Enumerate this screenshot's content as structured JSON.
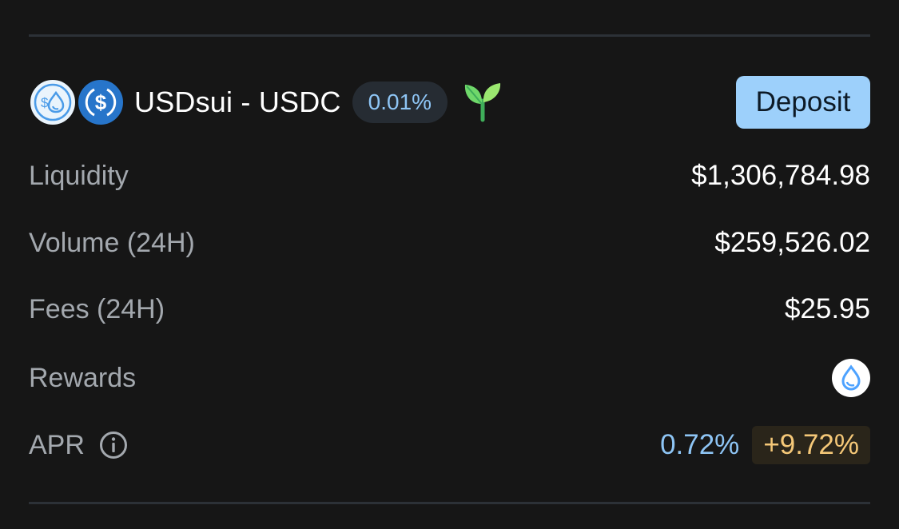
{
  "pool": {
    "pair_name": "USDsui - USDC",
    "fee_tier": "0.01%",
    "token_a_icon": "usdsui-token-icon",
    "token_b_icon": "usdc-token-icon",
    "incentive_icon": "sprout-icon",
    "deposit_label": "Deposit"
  },
  "stats": {
    "liquidity": {
      "label": "Liquidity",
      "value": "$1,306,784.98"
    },
    "volume": {
      "label": "Volume (24H)",
      "value": "$259,526.02"
    },
    "fees": {
      "label": "Fees (24H)",
      "value": "$25.95"
    },
    "rewards": {
      "label": "Rewards",
      "icon": "sui-token-icon"
    },
    "apr": {
      "label": "APR",
      "base": "0.72%",
      "bonus": "+9.72%"
    }
  },
  "colors": {
    "background": "#161616",
    "accent_blue": "#8ec5f5",
    "deposit_button": "#9dd0fb",
    "bonus_gold": "#f5c878",
    "usdc_blue": "#2775ca"
  }
}
